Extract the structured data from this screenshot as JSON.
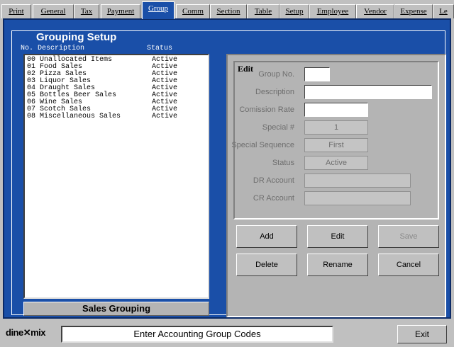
{
  "tabs": [
    {
      "label": "Print"
    },
    {
      "label": "General"
    },
    {
      "label": "Tax"
    },
    {
      "label": "Payment"
    },
    {
      "label": "Group"
    },
    {
      "label": "Comm"
    },
    {
      "label": "Section"
    },
    {
      "label": "Table"
    },
    {
      "label": "Setup"
    },
    {
      "label": "Employee"
    },
    {
      "label": "Vendor"
    },
    {
      "label": "Expense"
    },
    {
      "label": "Le"
    }
  ],
  "active_tab": "Group",
  "title": "Grouping Setup",
  "list": {
    "col_desc": "No. Description",
    "col_status": "Status",
    "rows": [
      {
        "desc": "00 Unallocated Items",
        "status": "Active"
      },
      {
        "desc": "01 Food Sales",
        "status": "Active"
      },
      {
        "desc": "02 Pizza Sales",
        "status": "Active"
      },
      {
        "desc": "03 Liquor Sales",
        "status": "Active"
      },
      {
        "desc": "04 Draught Sales",
        "status": "Active"
      },
      {
        "desc": "05 Bottles Beer Sales",
        "status": "Active"
      },
      {
        "desc": "06 Wine Sales",
        "status": "Active"
      },
      {
        "desc": "07 Scotch Sales",
        "status": "Active"
      },
      {
        "desc": "08 Miscellaneous Sales",
        "status": "Active"
      }
    ]
  },
  "sales_grouping_label": "Sales Grouping",
  "edit": {
    "header": "Edit",
    "group_no_label": "Group No.",
    "group_no_value": "",
    "description_label": "Description",
    "description_value": "",
    "comission_label": "Comission Rate",
    "comission_value": "",
    "special_label": "Special #",
    "special_value": "1",
    "special_seq_label": "Special Sequence",
    "special_seq_value": "First",
    "status_label": "Status",
    "status_value": "Active",
    "dr_label": "DR Account",
    "dr_value": "",
    "cr_label": "CR Account",
    "cr_value": ""
  },
  "buttons": {
    "add": "Add",
    "edit": "Edit",
    "save": "Save",
    "delete": "Delete",
    "rename": "Rename",
    "cancel": "Cancel"
  },
  "footer": {
    "logo": "dine✕mix",
    "status": "Enter Accounting Group Codes",
    "exit": "Exit"
  }
}
